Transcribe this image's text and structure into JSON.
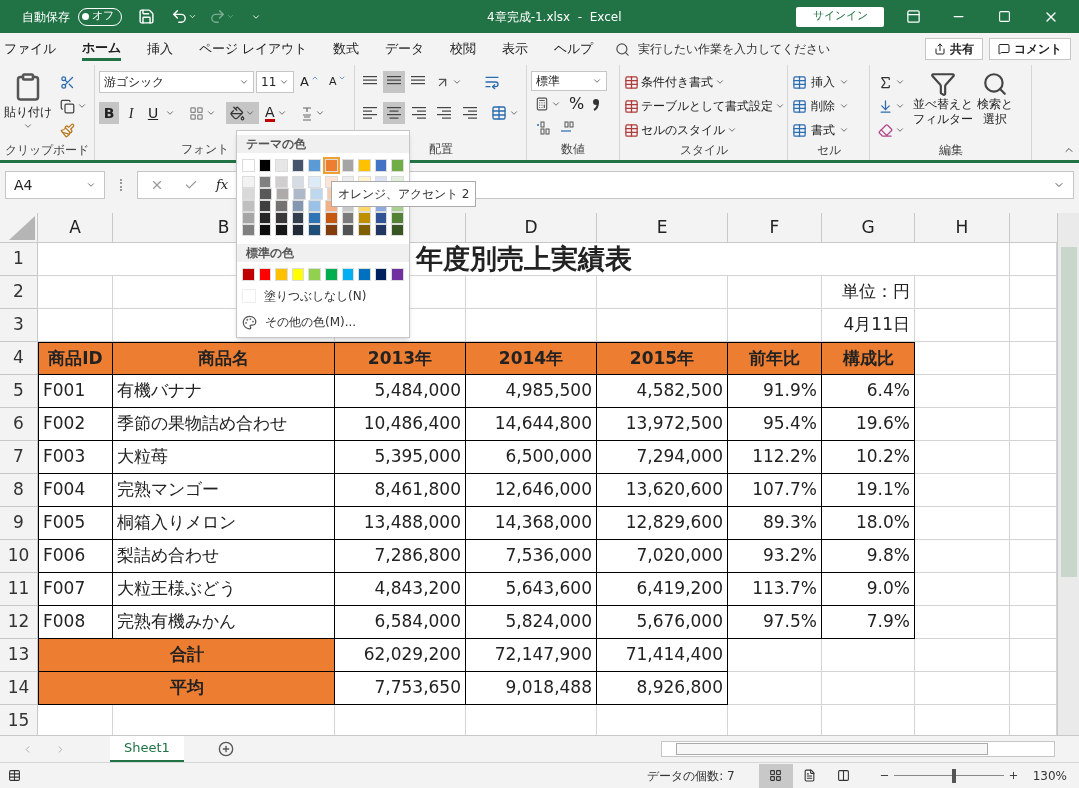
{
  "title_bar": {
    "autosave_label": "自動保存",
    "autosave_toggle": {
      "label": "オフ",
      "on": false
    },
    "title": "4章完成-1.xlsx  -  Excel",
    "signin": "サインイン"
  },
  "ribbon_tabs": [
    {
      "label": "ファイル",
      "selected": false
    },
    {
      "label": "ホーム",
      "selected": true
    },
    {
      "label": "挿入",
      "selected": false
    },
    {
      "label": "ページ レイアウト",
      "selected": false
    },
    {
      "label": "数式",
      "selected": false
    },
    {
      "label": "データ",
      "selected": false
    },
    {
      "label": "校閲",
      "selected": false
    },
    {
      "label": "表示",
      "selected": false
    },
    {
      "label": "ヘルプ",
      "selected": false
    }
  ],
  "tell_me": {
    "placeholder": "実行したい作業を入力してください"
  },
  "share": "共有",
  "comment": "コメント",
  "ribbon": {
    "clipboard": {
      "paste": "貼り付け",
      "label": "クリップボード"
    },
    "font": {
      "font_name": "游ゴシック",
      "font_size": "11",
      "grow": "A",
      "shrink": "A",
      "styles": [
        {
          "label": "B",
          "pressed": true
        },
        {
          "label": "I",
          "pressed": false
        },
        {
          "label": "U",
          "pressed": false
        }
      ],
      "fill_pressed": true,
      "font_color": "A",
      "label": "フォント"
    },
    "alignment": {
      "vertical_pressed": [
        false,
        true,
        false
      ],
      "horizontal_pressed": [
        false,
        true,
        false
      ],
      "label": "配置"
    },
    "number": {
      "format": "標準",
      "percent": "%",
      "label": "数値"
    },
    "styles": {
      "items": [
        "条件付き書式",
        "テーブルとして書式設定",
        "セルのスタイル"
      ],
      "label": "スタイル"
    },
    "cells": {
      "items": [
        "挿入",
        "削除",
        "書式"
      ],
      "label": "セル"
    },
    "editing": {
      "sort": [
        "並べ替えと",
        "フィルター"
      ],
      "find": [
        "検索と",
        "選択"
      ],
      "label": "編集"
    }
  },
  "formula_bar": {
    "name_box": "A4",
    "function_label": "fx"
  },
  "columns": [
    "A",
    "B",
    "D",
    "E",
    "F",
    "G",
    "H"
  ],
  "rows": [
    {
      "number": "1",
      "kind": "title",
      "title": "年度別売上実績表"
    },
    {
      "number": "2",
      "kind": "note",
      "text": "単位：円"
    },
    {
      "number": "3",
      "kind": "note",
      "text": "4月11日"
    },
    {
      "number": "4",
      "kind": "header",
      "cells": [
        "商品ID",
        "商品名",
        "2013年",
        "2014年",
        "2015年",
        "前年比",
        "構成比"
      ]
    },
    {
      "number": "5",
      "kind": "data",
      "cells": [
        "F001",
        "有機バナナ",
        "5,484,000",
        "4,985,500",
        "4,582,500",
        "91.9%",
        "6.4%"
      ]
    },
    {
      "number": "6",
      "kind": "data",
      "cells": [
        "F002",
        "季節の果物詰め合わせ",
        "10,486,400",
        "14,644,800",
        "13,972,500",
        "95.4%",
        "19.6%"
      ]
    },
    {
      "number": "7",
      "kind": "data",
      "cells": [
        "F003",
        "大粒苺",
        "5,395,000",
        "6,500,000",
        "7,294,000",
        "112.2%",
        "10.2%"
      ]
    },
    {
      "number": "8",
      "kind": "data",
      "cells": [
        "F004",
        "完熟マンゴー",
        "8,461,800",
        "12,646,000",
        "13,620,600",
        "107.7%",
        "19.1%"
      ]
    },
    {
      "number": "9",
      "kind": "data",
      "cells": [
        "F005",
        "桐箱入りメロン",
        "13,488,000",
        "14,368,000",
        "12,829,600",
        "89.3%",
        "18.0%"
      ]
    },
    {
      "number": "10",
      "kind": "data",
      "cells": [
        "F006",
        "梨詰め合わせ",
        "7,286,800",
        "7,536,000",
        "7,020,000",
        "93.2%",
        "9.8%"
      ]
    },
    {
      "number": "11",
      "kind": "data",
      "cells": [
        "F007",
        "大粒王様ぶどう",
        "4,843,200",
        "5,643,600",
        "6,419,200",
        "113.7%",
        "9.0%"
      ]
    },
    {
      "number": "12",
      "kind": "data",
      "cells": [
        "F008",
        "完熟有機みかん",
        "6,584,000",
        "5,824,000",
        "5,676,000",
        "97.5%",
        "7.9%"
      ]
    },
    {
      "number": "13",
      "kind": "summary",
      "label": "合計",
      "cells": [
        "62,029,200",
        "72,147,900",
        "71,414,400"
      ]
    },
    {
      "number": "14",
      "kind": "summary",
      "label": "平均",
      "cells": [
        "7,753,650",
        "9,018,488",
        "8,926,800"
      ]
    },
    {
      "number": "15",
      "kind": "blank"
    }
  ],
  "color_dropdown": {
    "theme_label": "テーマの色",
    "theme_colors": [
      {
        "color": "#ffffff",
        "selected": false
      },
      {
        "color": "#000000",
        "selected": false
      },
      {
        "color": "#e7e6e6",
        "selected": false
      },
      {
        "color": "#44546a",
        "selected": false
      },
      {
        "color": "#5b9bd5",
        "selected": false
      },
      {
        "color": "#ed7d31",
        "selected": true
      },
      {
        "color": "#a5a5a5",
        "selected": false
      },
      {
        "color": "#ffc000",
        "selected": false
      },
      {
        "color": "#4472c4",
        "selected": false
      },
      {
        "color": "#70ad47",
        "selected": false
      }
    ],
    "shade_rows": [
      [
        {
          "color": "#f2f2f2"
        },
        {
          "color": "#808080"
        },
        {
          "color": "#d0cece"
        },
        {
          "color": "#d6dce4"
        },
        {
          "color": "#ddebf7"
        },
        {
          "color": "#fce4d6"
        },
        {
          "color": "#ededed"
        },
        {
          "color": "#fff2cc"
        },
        {
          "color": "#d9e1f2"
        },
        {
          "color": "#e2efda"
        }
      ],
      [
        {
          "color": "#d9d9d9"
        },
        {
          "color": "#595959"
        },
        {
          "color": "#aeaaaa"
        },
        {
          "color": "#adb9ca"
        },
        {
          "color": "#bdd7ee"
        },
        {
          "color": "#f8cbad"
        }
      ],
      [
        {
          "color": "#bfbfbf"
        },
        {
          "color": "#404040"
        },
        {
          "color": "#757171"
        },
        {
          "color": "#8497b0"
        },
        {
          "color": "#9bc2e6"
        },
        {
          "color": "#f4b084"
        },
        {
          "color": "#c9c9c9"
        },
        {
          "color": "#ffd966"
        },
        {
          "color": "#8ea9db"
        },
        {
          "color": "#a9d08e"
        }
      ],
      [
        {
          "color": "#a6a6a6"
        },
        {
          "color": "#262626"
        },
        {
          "color": "#3a3838"
        },
        {
          "color": "#333f4f"
        },
        {
          "color": "#2f75b5"
        },
        {
          "color": "#c65911"
        },
        {
          "color": "#7b7b7b"
        },
        {
          "color": "#bf8f00"
        },
        {
          "color": "#305496"
        },
        {
          "color": "#548235"
        }
      ],
      [
        {
          "color": "#808080"
        },
        {
          "color": "#0d0d0d"
        },
        {
          "color": "#171616"
        },
        {
          "color": "#222a35"
        },
        {
          "color": "#1f4e78"
        },
        {
          "color": "#833c0c"
        },
        {
          "color": "#525252"
        },
        {
          "color": "#806000"
        },
        {
          "color": "#203764"
        },
        {
          "color": "#375623"
        }
      ]
    ],
    "standard_label": "標準の色",
    "standard_colors": [
      {
        "color": "#c00000"
      },
      {
        "color": "#ff0000"
      },
      {
        "color": "#ffc000"
      },
      {
        "color": "#ffff00"
      },
      {
        "color": "#92d050"
      },
      {
        "color": "#00b050"
      },
      {
        "color": "#00b0f0"
      },
      {
        "color": "#0070c0"
      },
      {
        "color": "#002060"
      },
      {
        "color": "#7030a0"
      }
    ],
    "no_fill": "塗りつぶしなし(N)",
    "more_colors": "その他の色(M)..."
  },
  "tooltip": "オレンジ、アクセント 2",
  "sheet_tabs": [
    {
      "label": "Sheet1",
      "selected": true
    }
  ],
  "status_bar": {
    "summary": "データの個数: 7",
    "views": [
      {
        "selected": true
      },
      {
        "selected": false
      },
      {
        "selected": false
      }
    ],
    "zoom": {
      "level": 0.55,
      "reading": "130%"
    }
  }
}
